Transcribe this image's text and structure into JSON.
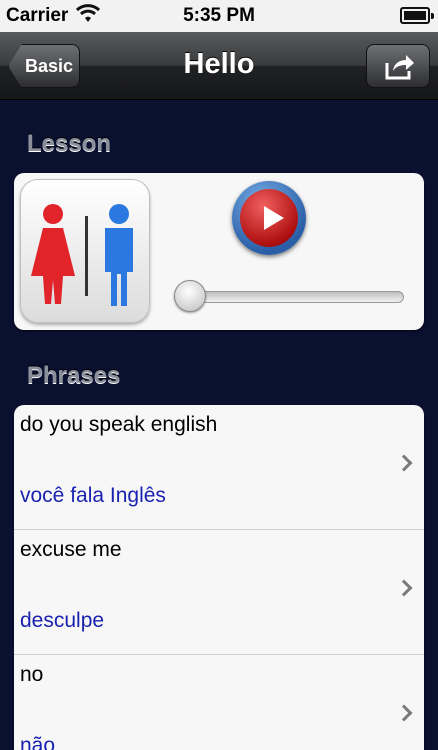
{
  "status_bar": {
    "carrier": "Carrier",
    "time": "5:35 PM"
  },
  "nav": {
    "back_label": "Basic",
    "title": "Hello",
    "share_icon": "share-icon"
  },
  "lesson": {
    "header": "Lesson",
    "icon": "restroom-icon",
    "progress": 0
  },
  "phrases": {
    "header": "Phrases",
    "items": [
      {
        "english": "do you speak english",
        "portuguese": "você fala Inglês"
      },
      {
        "english": "excuse me",
        "portuguese": "desculpe"
      },
      {
        "english": "no",
        "portuguese": "não"
      }
    ]
  },
  "colors": {
    "background": "#0a1030",
    "translation": "#1a23b0"
  }
}
